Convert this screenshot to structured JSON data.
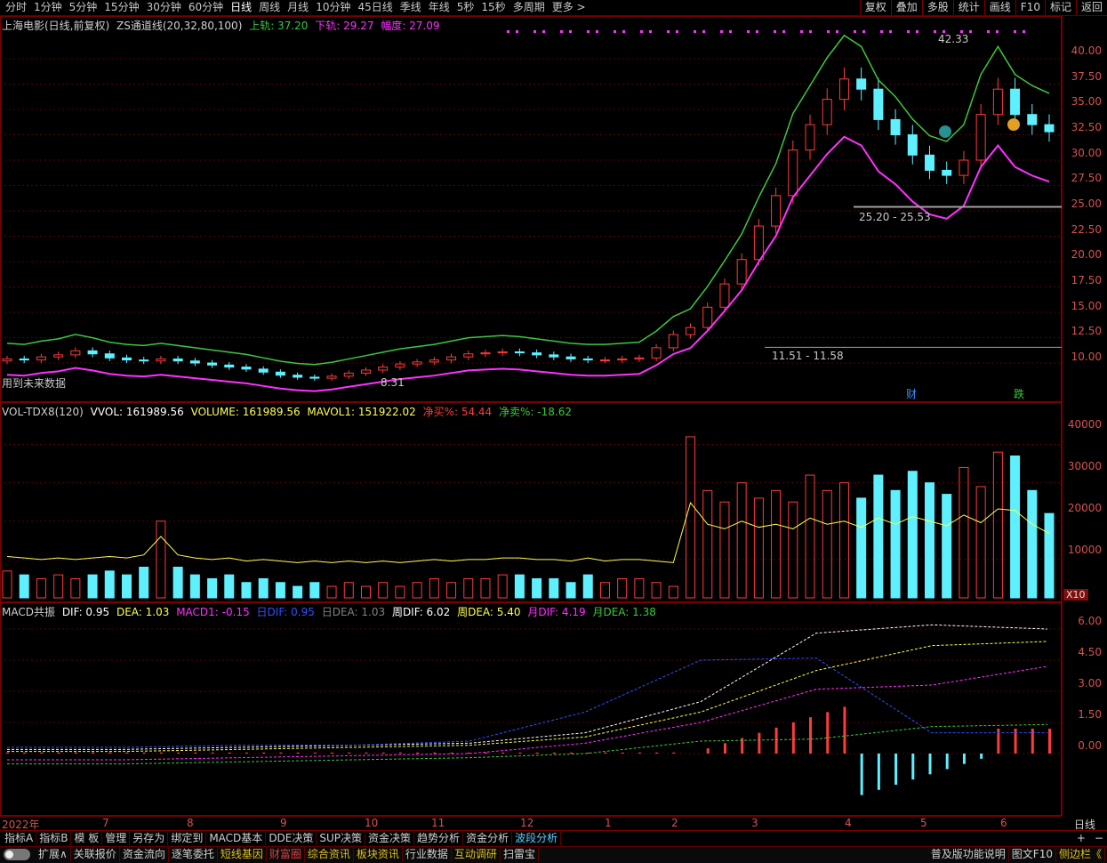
{
  "topbar": {
    "periods": [
      "分时",
      "1分钟",
      "5分钟",
      "15分钟",
      "30分钟",
      "60分钟",
      "日线",
      "周线",
      "月线",
      "10分钟",
      "45日线",
      "季线",
      "年线",
      "5秒",
      "15秒",
      "多周期",
      "更多 >"
    ],
    "active_period": "日线",
    "tools": [
      "复权",
      "叠加",
      "多股",
      "统计",
      "画线",
      "F10",
      "标记",
      "返回"
    ]
  },
  "main": {
    "stock_title": "上海电影(日线,前复权)",
    "indicator": "ZS通道线(20,32,80,100)",
    "upper_label": "上轨: 37.20",
    "lower_label": "下轨: 29.27",
    "width_label": "幅度: 27.09",
    "colors": {
      "upper": "#3cc83c",
      "lower": "#ff30ff",
      "up": "#ff3b3b",
      "down": "#5ff0ff"
    },
    "yticks": [
      "40.00",
      "37.50",
      "35.00",
      "32.50",
      "30.00",
      "27.50",
      "25.00",
      "22.50",
      "20.00",
      "17.50",
      "15.00",
      "12.50",
      "10.00"
    ],
    "annotations": {
      "high": "42.33",
      "low": "8.31",
      "level_high": "25.20 - 25.53",
      "level_low": "11.51 - 11.58",
      "future_note": "用到未来数据",
      "marker_cai": "财",
      "marker_die": "跌"
    },
    "price_series": {
      "open": [
        10.2,
        10.4,
        10.3,
        10.6,
        10.8,
        11.2,
        10.9,
        10.5,
        10.3,
        10.2,
        10.4,
        10.2,
        10.0,
        9.8,
        9.6,
        9.4,
        9.1,
        8.8,
        8.6,
        8.5,
        8.7,
        9.0,
        9.3,
        9.6,
        9.9,
        10.1,
        10.3,
        10.6,
        10.9,
        11.0,
        11.1,
        11.0,
        10.8,
        10.6,
        10.4,
        10.3,
        10.3,
        10.4,
        10.5,
        11.5,
        12.8,
        13.5,
        15.5,
        17.8,
        20.2,
        23.5,
        26.5,
        31.0,
        33.5,
        36.0,
        38.0,
        37.0,
        34.0,
        32.5,
        30.5,
        29.0,
        28.5,
        30.0,
        34.5,
        37.0,
        34.5,
        33.5
      ],
      "close": [
        10.4,
        10.3,
        10.6,
        10.8,
        11.2,
        10.9,
        10.5,
        10.3,
        10.2,
        10.4,
        10.2,
        10.0,
        9.8,
        9.6,
        9.4,
        9.1,
        8.8,
        8.6,
        8.5,
        8.7,
        9.0,
        9.3,
        9.6,
        9.9,
        10.1,
        10.3,
        10.6,
        10.9,
        11.0,
        11.1,
        11.0,
        10.8,
        10.6,
        10.4,
        10.3,
        10.3,
        10.4,
        10.5,
        11.5,
        12.8,
        13.5,
        15.5,
        17.8,
        20.2,
        23.5,
        26.5,
        31.0,
        33.5,
        36.0,
        38.0,
        37.0,
        34.0,
        32.5,
        30.5,
        29.0,
        28.5,
        30.0,
        34.5,
        37.0,
        34.5,
        33.5,
        32.8
      ]
    }
  },
  "volume": {
    "indicator": "VOL-TDX8(120)",
    "vvol": "VVOL: 161989.56",
    "volume_val": "VOLUME: 161989.56",
    "mavol1": "MAVOL1: 151922.02",
    "net_buy": "净买%: 54.44",
    "net_sell": "净卖%: -18.62",
    "yticks": [
      "40000",
      "30000",
      "20000",
      "10000"
    ],
    "unit": "X10",
    "values": [
      7,
      6,
      5,
      6,
      5,
      6,
      7,
      6,
      8,
      20,
      8,
      6,
      5,
      6,
      4,
      5,
      4,
      3,
      4,
      3,
      4,
      3,
      4,
      3,
      4,
      5,
      4,
      5,
      5,
      6,
      6,
      5,
      5,
      4,
      6,
      4,
      5,
      5,
      4,
      3,
      42,
      28,
      25,
      30,
      26,
      28,
      25,
      32,
      28,
      30,
      26,
      32,
      28,
      33,
      30,
      27,
      34,
      29,
      38,
      37,
      28,
      22
    ]
  },
  "macd": {
    "indicator": "MACD共振",
    "dif": "DIF: 0.95",
    "dea": "DEA: 1.03",
    "macd1": "MACD1: -0.15",
    "ri_dif": "日DIF: 0.95",
    "ri_dea": "日DEA: 1.03",
    "zhou_dif": "周DIF: 6.02",
    "zhou_dea": "周DEA: 5.40",
    "yue_dif": "月DIF: 4.19",
    "yue_dea": "月DEA: 1.38",
    "yticks": [
      "6.00",
      "4.50",
      "3.00",
      "1.50",
      "0.00"
    ]
  },
  "xaxis": {
    "labels": [
      "2022年",
      "7",
      "8",
      "9",
      "10",
      "11",
      "12",
      "1",
      "2",
      "3",
      "4",
      "5",
      "6"
    ],
    "period_label": "日线"
  },
  "bottom_tabs": [
    "指标A",
    "指标B",
    "模 板",
    "管理",
    "另存为",
    "绑定到",
    "MACD基本",
    "DDE决策",
    "SUP决策",
    "资金决策",
    "趋势分析",
    "资金分析",
    "波段分析"
  ],
  "active_bottom_tab": "波段分析",
  "zoom": {
    "plus": "+",
    "minus": "−"
  },
  "statusbar": {
    "expand": "扩展∧",
    "items": [
      "关联报价",
      "资金流向",
      "逐笔委托",
      "短线基因",
      "财富圈",
      "综合资讯",
      "板块资讯",
      "行业数据",
      "互动调研",
      "扫雷宝"
    ],
    "right_items": [
      "普及版功能说明",
      "图文F10",
      "侧边栏《"
    ]
  }
}
